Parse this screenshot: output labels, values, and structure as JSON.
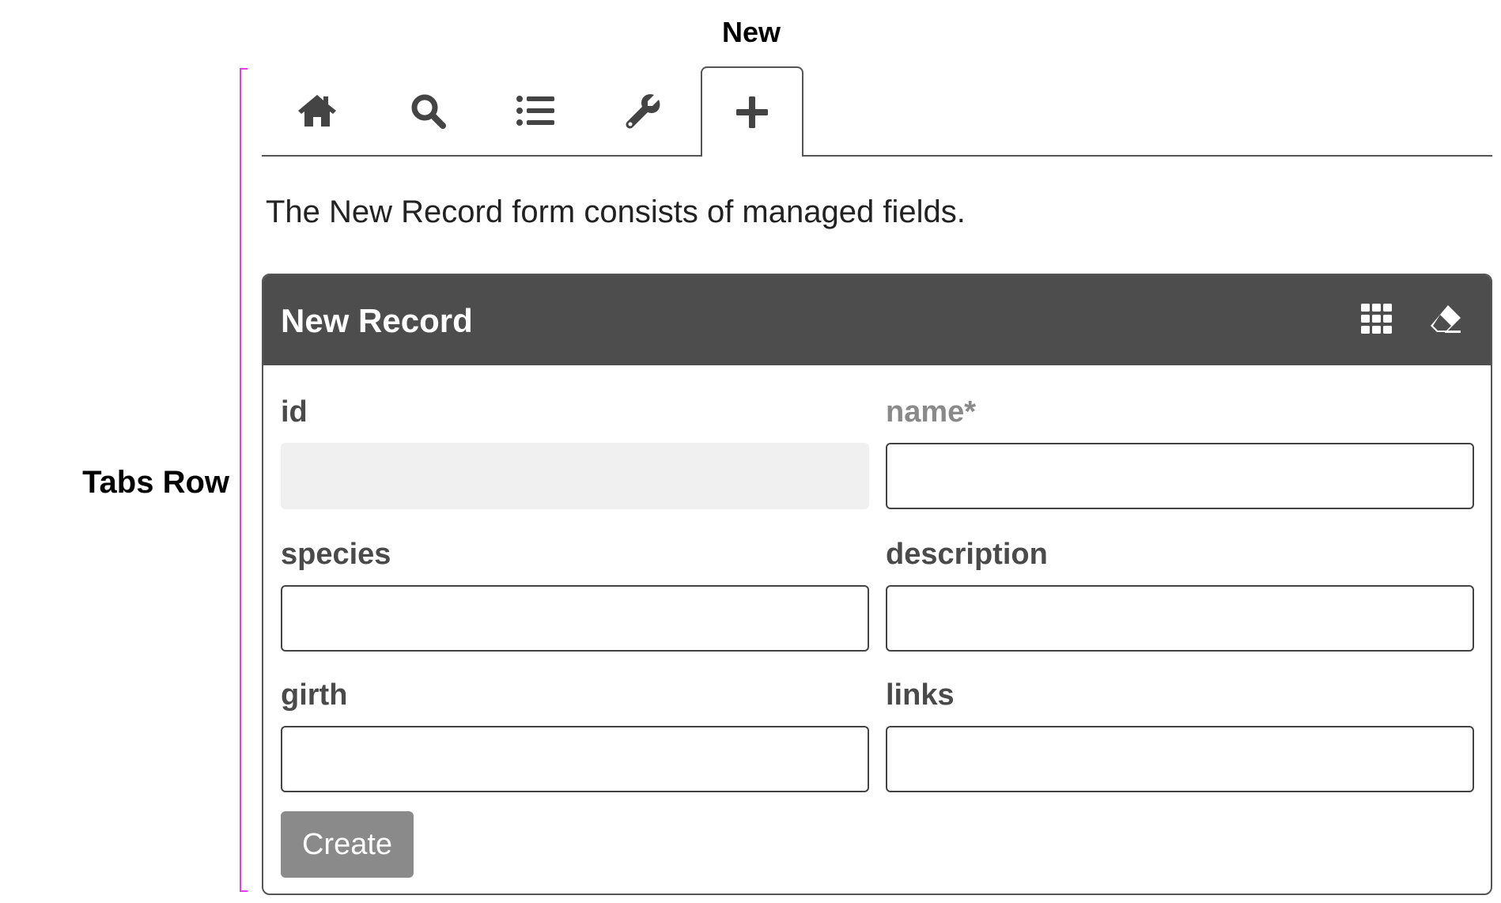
{
  "annotations": {
    "new_label": "New",
    "tabs_row_label": "Tabs Row"
  },
  "tabs": [
    {
      "icon": "home-icon",
      "active": false
    },
    {
      "icon": "search-icon",
      "active": false
    },
    {
      "icon": "list-icon",
      "active": false
    },
    {
      "icon": "wrench-icon",
      "active": false
    },
    {
      "icon": "plus-icon",
      "active": true
    }
  ],
  "intro_text": "The New Record form consists of managed fields.",
  "form": {
    "title": "New Record",
    "header_icons": [
      "grid-icon",
      "eraser-icon"
    ],
    "fields": {
      "id": {
        "label": "id",
        "value": "",
        "disabled": true
      },
      "name": {
        "label": "name*",
        "value": "",
        "required": true
      },
      "species": {
        "label": "species",
        "value": ""
      },
      "description": {
        "label": "description",
        "value": ""
      },
      "girth": {
        "label": "girth",
        "value": ""
      },
      "links": {
        "label": "links",
        "value": ""
      }
    },
    "submit_label": "Create"
  },
  "colors": {
    "header_bg": "#4d4d4d",
    "annotation_bracket": "#e040e8",
    "button_bg": "#8a8a8a",
    "disabled_input_bg": "#f0f0f0"
  }
}
